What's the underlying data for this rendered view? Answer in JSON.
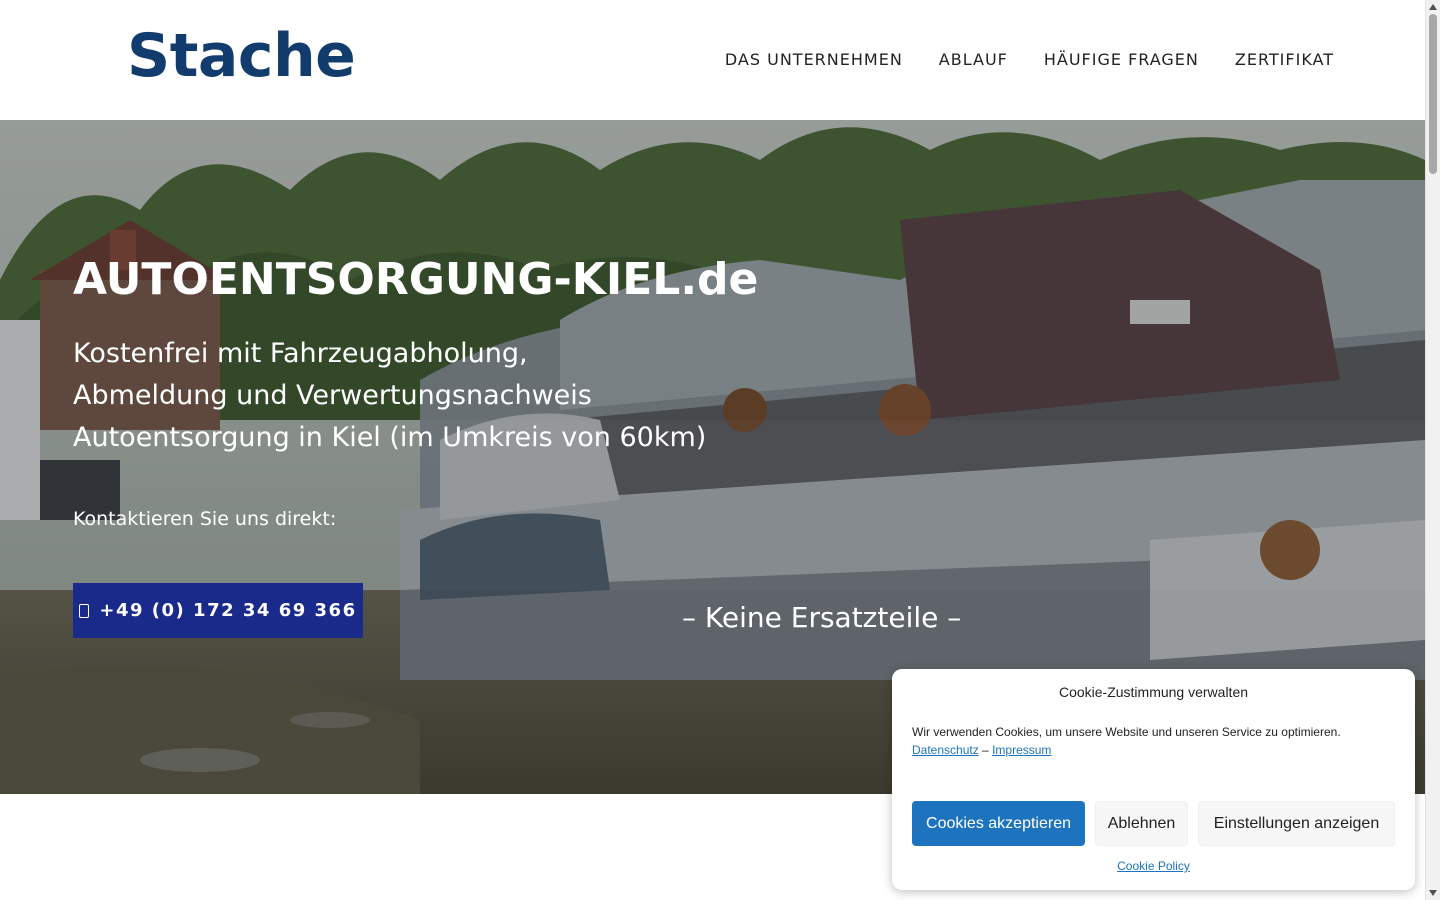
{
  "header": {
    "logo": "Stache",
    "nav": [
      {
        "label": "DAS UNTERNEHMEN"
      },
      {
        "label": "ABLAUF"
      },
      {
        "label": "HÄUFIGE FRAGEN"
      },
      {
        "label": "ZERTIFIKAT"
      }
    ]
  },
  "hero": {
    "title": "AUTOENTSORGUNG-KIEL.de",
    "subtitle_lines": [
      "Kostenfrei mit Fahrzeugabholung,",
      "Abmeldung und Verwertungsnachweis",
      "Autoentsorgung in Kiel (im Umkreis von 60km)"
    ],
    "contact_label": "Kontaktieren Sie uns direkt:",
    "phone_button": "+49 (0) 172 34 69 366",
    "phone_icon": "phone-icon",
    "tagline": "– Keine Ersatzteile –",
    "background": "photo of a scrapyard with stacked wrecked cars"
  },
  "cookie_banner": {
    "title": "Cookie-Zustimmung verwalten",
    "text": "Wir verwenden Cookies, um unsere Website und unseren Service zu optimieren.",
    "link_privacy": "Datenschutz",
    "separator": "–",
    "link_imprint": "Impressum",
    "accept_label": "Cookies akzeptieren",
    "deny_label": "Ablehnen",
    "settings_label": "Einstellungen anzeigen",
    "policy_label": "Cookie Policy"
  },
  "colors": {
    "logo": "#123c6e",
    "phone_button": "#1a2a8a",
    "cookie_accept": "#1e73be",
    "link": "#1e73be"
  }
}
